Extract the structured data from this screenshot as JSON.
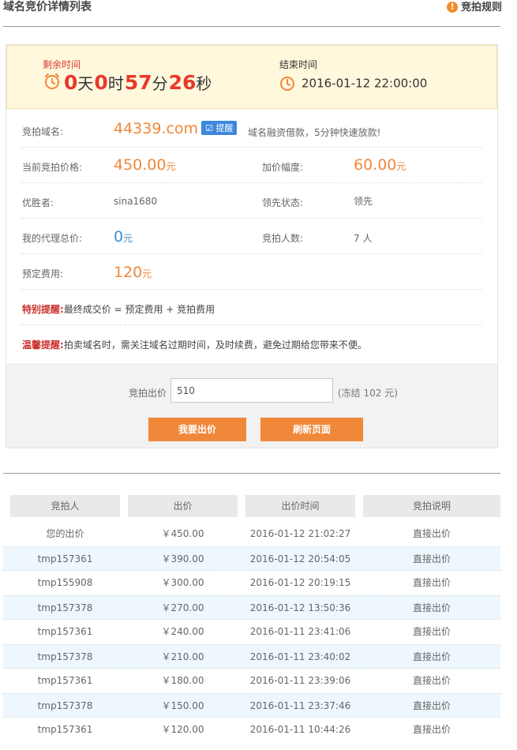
{
  "header": {
    "title": "域名竞价详情列表",
    "rules_label": "竞拍规则",
    "rules_icon": "info-icon"
  },
  "timer": {
    "remaining_label": "剩余时间",
    "days": "0",
    "days_unit": "天",
    "hours": "0",
    "hours_unit": "时",
    "minutes": "57",
    "minutes_unit": "分",
    "seconds": "26",
    "seconds_unit": "秒",
    "end_label": "结束时间",
    "end_time": "2016-01-12 22:00:00"
  },
  "details": {
    "domain_label": "竞拍域名:",
    "domain": "44339.com",
    "remind_label": "提醒",
    "loan_text": "域名融资借款，5分钟快速放款!",
    "current_price_label": "当前竞拍价格:",
    "current_price": "450.00",
    "currency_unit": "元",
    "increment_label": "加价幅度:",
    "increment": "60.00",
    "winner_label": "优胜者:",
    "winner": "sina1680",
    "lead_label": "领先状态:",
    "lead_status": "领先",
    "proxy_label": "我的代理总价:",
    "proxy_total": "0",
    "bidders_label": "竞拍人数:",
    "bidders": "7 人",
    "reserve_label": "预定费用:",
    "reserve_fee": "120",
    "special_key": "特别提醒:",
    "special_text": "最终成交价 = 预定费用 + 竞拍费用",
    "warm_key": "温馨提醒:",
    "warm_text": "拍卖域名时，需关注域名过期时间，及时续费，避免过期给您带来不便。"
  },
  "bid_form": {
    "label": "竞拍出价",
    "value": "510",
    "freeze_note": "(冻结 102 元)",
    "submit_label": "我要出价",
    "refresh_label": "刷新页面"
  },
  "history": {
    "columns": [
      "竞拍人",
      "出价",
      "出价时间",
      "竞拍说明"
    ],
    "rows": [
      {
        "bidder": "您的出价",
        "price": "￥450.00",
        "time": "2016-01-12 21:02:27",
        "note": "直接出价"
      },
      {
        "bidder": "tmp157361",
        "price": "￥390.00",
        "time": "2016-01-12 20:54:05",
        "note": "直接出价"
      },
      {
        "bidder": "tmp155908",
        "price": "￥300.00",
        "time": "2016-01-12 20:19:15",
        "note": "直接出价"
      },
      {
        "bidder": "tmp157378",
        "price": "￥270.00",
        "time": "2016-01-12 13:50:36",
        "note": "直接出价"
      },
      {
        "bidder": "tmp157361",
        "price": "￥240.00",
        "time": "2016-01-11 23:41:06",
        "note": "直接出价"
      },
      {
        "bidder": "tmp157378",
        "price": "￥210.00",
        "time": "2016-01-11 23:40:02",
        "note": "直接出价"
      },
      {
        "bidder": "tmp157361",
        "price": "￥180.00",
        "time": "2016-01-11 23:39:06",
        "note": "直接出价"
      },
      {
        "bidder": "tmp157378",
        "price": "￥150.00",
        "time": "2016-01-11 23:37:46",
        "note": "直接出价"
      },
      {
        "bidder": "tmp157361",
        "price": "￥120.00",
        "time": "2016-01-11 10:44:26",
        "note": "直接出价"
      }
    ]
  },
  "colors": {
    "accent": "#f0883a",
    "countdown": "#e8382b",
    "link": "#1b8fbf",
    "status": "#3f8fd0",
    "warning": "#c9302c"
  }
}
